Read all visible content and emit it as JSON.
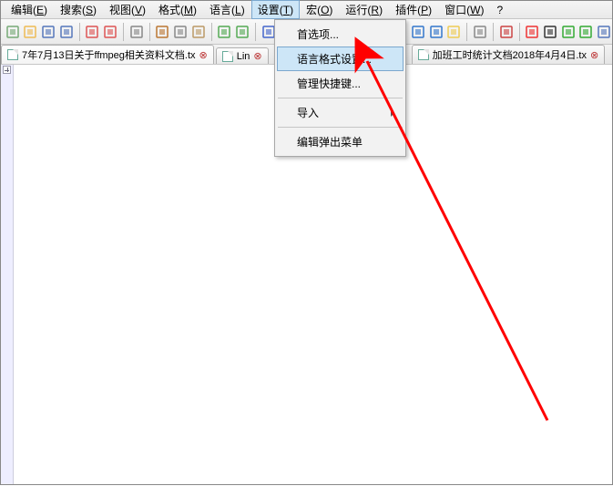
{
  "menubar": [
    {
      "label": "编辑",
      "mnem": "E"
    },
    {
      "label": "搜索",
      "mnem": "S"
    },
    {
      "label": "视图",
      "mnem": "V"
    },
    {
      "label": "格式",
      "mnem": "M"
    },
    {
      "label": "语言",
      "mnem": "L"
    },
    {
      "label": "设置",
      "mnem": "T"
    },
    {
      "label": "宏",
      "mnem": "O"
    },
    {
      "label": "运行",
      "mnem": "R"
    },
    {
      "label": "插件",
      "mnem": "P"
    },
    {
      "label": "窗口",
      "mnem": "W"
    },
    {
      "label": "?",
      "mnem": ""
    }
  ],
  "dropdown": {
    "items": [
      {
        "label": "首选项..."
      },
      {
        "label": "语言格式设置...",
        "hover": true
      },
      {
        "label": "管理快捷键..."
      },
      {
        "sep": true
      },
      {
        "label": "导入",
        "submenu": true
      },
      {
        "sep": true
      },
      {
        "label": "编辑弹出菜单"
      }
    ]
  },
  "tabs": [
    {
      "label": "7年7月13日关于ffmpeg相关资料文档.tx",
      "active": true
    },
    {
      "label": "Lin"
    },
    {
      "label": "加班工时统计文档2018年4月4日.tx"
    }
  ],
  "toolbar_icons": [
    "new-file",
    "open-file",
    "save",
    "save-all",
    "sep",
    "close",
    "close-all",
    "sep",
    "print",
    "sep",
    "cut",
    "copy",
    "paste",
    "sep",
    "undo",
    "redo",
    "sep",
    "find",
    "replace",
    "sep",
    "zoom-in",
    "zoom-out",
    "sep",
    "sync",
    "word-wrap",
    "show-all",
    "sep",
    "indent-guide",
    "fold",
    "unfold",
    "sep",
    "hidden",
    "sep",
    "doc-list",
    "sep",
    "record-macro",
    "stop-macro",
    "play-macro",
    "play-multi",
    "save-macro"
  ],
  "colors": {
    "menu_highlight": "#cde6f7",
    "arrow": "#ff0000"
  }
}
